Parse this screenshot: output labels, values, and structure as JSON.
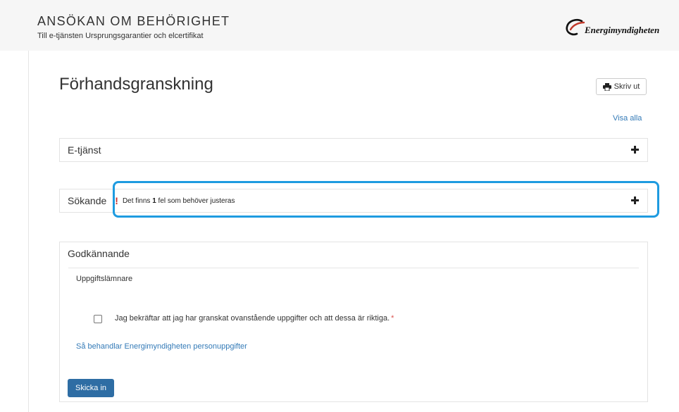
{
  "header": {
    "title": "ANSÖKAN OM BEHÖRIGHET",
    "subtitle": "Till e-tjänsten Ursprungsgarantier och elcertifikat",
    "logo_text": "Energimyndigheten"
  },
  "main": {
    "page_title": "Förhandsgranskning",
    "print_label": "Skriv ut",
    "show_all_label": "Visa alla"
  },
  "panels": {
    "etjanst": {
      "title": "E-tjänst"
    },
    "sokande": {
      "title": "Sökande",
      "error_mark": "!",
      "error_prefix": "Det finns ",
      "error_count": "1",
      "error_suffix": " fel som behöver justeras"
    },
    "godkannande": {
      "title": "Godkännande",
      "subheading": "Uppgiftslämnare",
      "confirm_text": "Jag bekräftar att jag har granskat ovanstående uppgifter och att dessa är riktiga.",
      "required_mark": "*",
      "privacy_link": "Så behandlar Energimyndigheten personuppgifter",
      "submit_label": "Skicka in"
    }
  },
  "colors": {
    "accent_link": "#337ab7",
    "primary_button": "#2e6da4",
    "error": "#c9302c",
    "highlight": "#1e9be0"
  },
  "icons": {
    "print": "printer-icon",
    "expand": "plus-icon",
    "logo": "swoosh-logo-icon"
  }
}
